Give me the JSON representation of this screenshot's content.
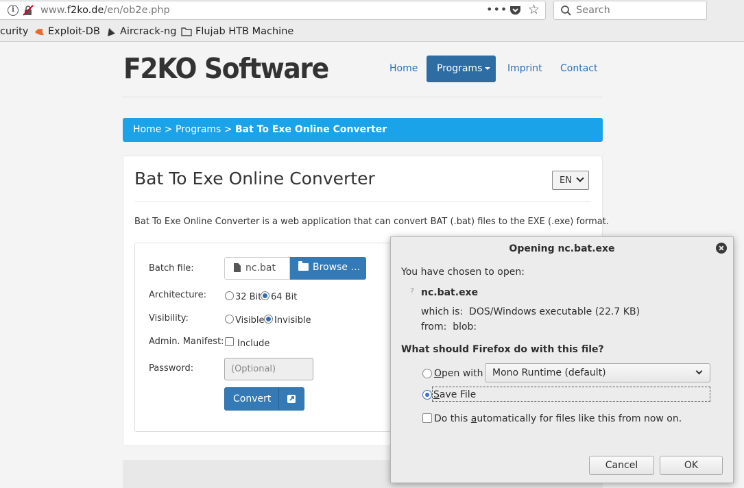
{
  "browser": {
    "url_prefix": "www.",
    "url_host": "f2ko.de",
    "url_path": "/en/ob2e.php",
    "search_placeholder": "Search",
    "menu_dots": "•••",
    "bookmarks": [
      {
        "label": "curity"
      },
      {
        "label": "Exploit-DB"
      },
      {
        "label": "Aircrack-ng"
      },
      {
        "label": "Flujab HTB Machine"
      }
    ]
  },
  "site": {
    "brand": "F2KO Software",
    "nav": {
      "home": "Home",
      "programs": "Programs",
      "imprint": "Imprint",
      "contact": "Contact"
    },
    "breadcrumb": {
      "home": "Home",
      "sep1": " > ",
      "programs": "Programs",
      "sep2": " > ",
      "current": "Bat To Exe Online Converter"
    }
  },
  "panel": {
    "title": "Bat To Exe Online Converter",
    "language": "EN",
    "description": "Bat To Exe Online Converter is a web application that can convert BAT (.bat) files to the EXE (.exe) format."
  },
  "form": {
    "batch_label": "Batch file:",
    "file_name": "nc.bat",
    "browse_label": "Browse …",
    "arch_label": "Architecture:",
    "arch_32": "32 Bit",
    "arch_64": "64 Bit",
    "arch_selected": "64 Bit",
    "vis_label": "Visibility:",
    "vis_visible": "Visible",
    "vis_invisible": "Invisible",
    "vis_selected": "Invisible",
    "manifest_label": "Admin. Manifest:",
    "manifest_include": "Include",
    "manifest_checked": false,
    "password_label": "Password:",
    "password_placeholder": "(Optional)",
    "convert_label": "Convert"
  },
  "dialog": {
    "title": "Opening nc.bat.exe",
    "chosen_text": "You have chosen to open:",
    "file_name": "nc.bat.exe",
    "which_is_label": "which is:",
    "which_is_value": "DOS/Windows executable (22.7 KB)",
    "from_label": "from:",
    "from_value": "blob:",
    "question": "What should Firefox do with this file?",
    "open_with_label_pre": "",
    "open_with_accel": "O",
    "open_with_label_post": "pen with",
    "open_with_app": "Mono Runtime (default)",
    "save_file_accel": "S",
    "save_file_label_post": "ave File",
    "selected_option": "Save File",
    "auto_pre": "Do this ",
    "auto_accel": "a",
    "auto_post": "utomatically for files like this from now on.",
    "auto_checked": false,
    "cancel_label": "Cancel",
    "ok_label": "OK"
  },
  "colors": {
    "primary_button": "#337ab7",
    "breadcrumb_bg": "#1aa3e8",
    "link": "#2a6fb6"
  }
}
